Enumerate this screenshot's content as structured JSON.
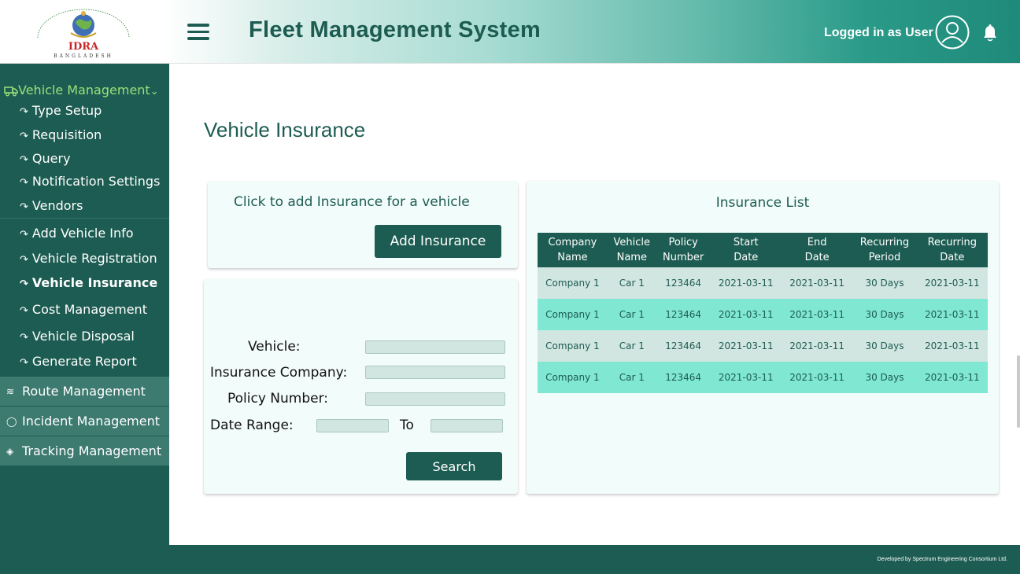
{
  "header": {
    "logo_text": "IDRA",
    "logo_sub": "BANGLADESH",
    "app_title": "Fleet Management System",
    "logged_in_text": "Logged in as User",
    "icons": [
      "menu-icon",
      "user-avatar-icon",
      "bell-icon"
    ]
  },
  "sidebar": {
    "section_label": "Vehicle Management",
    "items": [
      {
        "label": "Type Setup"
      },
      {
        "label": "Requisition"
      },
      {
        "label": "Query"
      },
      {
        "label": "Notification Settings"
      },
      {
        "label": "Vendors"
      },
      {
        "label": "Add Vehicle Info"
      },
      {
        "label": "Vehicle Registration"
      },
      {
        "label": "Vehicle Insurance",
        "active": true
      },
      {
        "label": "Cost Management"
      },
      {
        "label": "Vehicle Disposal"
      },
      {
        "label": "Generate Report"
      }
    ],
    "groups": [
      {
        "label": "Route Management",
        "icon": "route-icon"
      },
      {
        "label": "Incident Management",
        "icon": "shield-icon"
      },
      {
        "label": "Tracking Management",
        "icon": "target-icon"
      }
    ]
  },
  "main": {
    "page_title": "Vehicle Insurance",
    "add_card": {
      "prompt": "Click to add Insurance for a vehicle",
      "button_label": "Add Insurance"
    },
    "search_form": {
      "vehicle_label": "Vehicle:",
      "vehicle_value": "",
      "company_label": "Insurance Company:",
      "company_value": "",
      "policy_label": "Policy Number:",
      "policy_value": "",
      "date_range_label": "Date Range:",
      "date_from_value": "",
      "to_label": "To",
      "date_to_value": "",
      "search_label": "Search"
    },
    "insurance_list": {
      "title": "Insurance List",
      "columns": [
        [
          "Company",
          "Name"
        ],
        [
          "Vehicle",
          "Name"
        ],
        [
          "Policy",
          "Number"
        ],
        [
          "Start",
          "Date"
        ],
        [
          "End",
          "Date"
        ],
        [
          "Recurring",
          "Period"
        ],
        [
          "Recurring",
          "Date"
        ]
      ],
      "rows": [
        [
          "Company 1",
          "Car 1",
          "123464",
          "2021-03-11",
          "2021-03-11",
          "30 Days",
          "2021-03-11"
        ],
        [
          "Company 1",
          "Car 1",
          "123464",
          "2021-03-11",
          "2021-03-11",
          "30 Days",
          "2021-03-11"
        ],
        [
          "Company 1",
          "Car 1",
          "123464",
          "2021-03-11",
          "2021-03-11",
          "30 Days",
          "2021-03-11"
        ],
        [
          "Company 1",
          "Car 1",
          "123464",
          "2021-03-11",
          "2021-03-11",
          "30 Days",
          "2021-03-11"
        ]
      ]
    }
  },
  "footer": {
    "credit": "Developed by Spectrum Engineering Consortium Ltd."
  },
  "colors": {
    "primary": "#1d5c52",
    "accent_green": "#9be07a",
    "row_light": "#d2e6e1",
    "row_mint": "#7fe7d2",
    "card_bg": "#f2fcfa"
  }
}
